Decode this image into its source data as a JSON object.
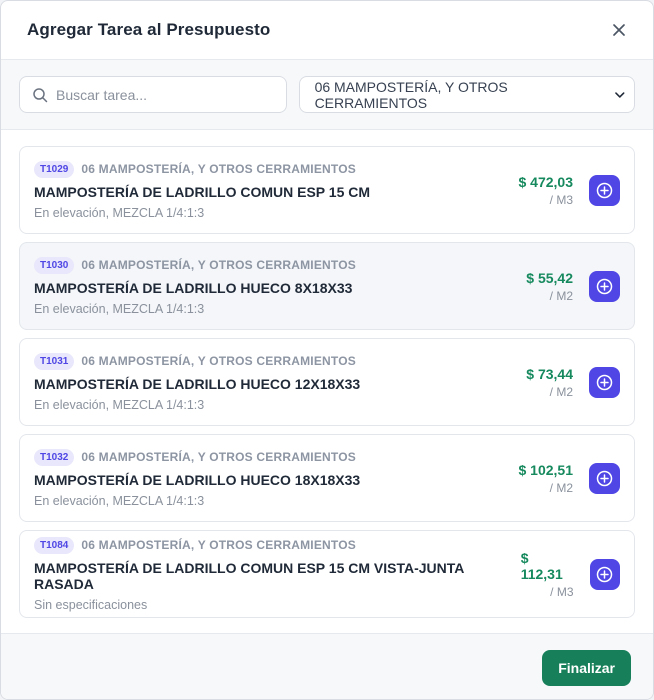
{
  "header": {
    "title": "Agregar Tarea al Presupuesto",
    "close_icon": "close-icon"
  },
  "toolbar": {
    "search_placeholder": "Buscar tarea...",
    "search_value": "",
    "category_selected": "06 MAMPOSTERÍA, Y OTROS CERRAMIENTOS"
  },
  "tasks": [
    {
      "code": "T1029",
      "category": "06 MAMPOSTERÍA, Y OTROS CERRAMIENTOS",
      "name": "MAMPOSTERÍA DE LADRILLO COMUN ESP 15 CM",
      "spec": "En elevación, MEZCLA 1/4:1:3",
      "price": "$ 472,03",
      "unit": "/ M3"
    },
    {
      "code": "T1030",
      "category": "06 MAMPOSTERÍA, Y OTROS CERRAMIENTOS",
      "name": "MAMPOSTERÍA DE LADRILLO HUECO 8X18X33",
      "spec": "En elevación, MEZCLA 1/4:1:3",
      "price": "$ 55,42",
      "unit": "/ M2"
    },
    {
      "code": "T1031",
      "category": "06 MAMPOSTERÍA, Y OTROS CERRAMIENTOS",
      "name": "MAMPOSTERÍA DE LADRILLO HUECO 12X18X33",
      "spec": "En elevación, MEZCLA 1/4:1:3",
      "price": "$ 73,44",
      "unit": "/ M2"
    },
    {
      "code": "T1032",
      "category": "06 MAMPOSTERÍA, Y OTROS CERRAMIENTOS",
      "name": "MAMPOSTERÍA DE LADRILLO HUECO 18X18X33",
      "spec": "En elevación, MEZCLA 1/4:1:3",
      "price": "$ 102,51",
      "unit": "/ M2"
    },
    {
      "code": "T1084",
      "category": "06 MAMPOSTERÍA, Y OTROS CERRAMIENTOS",
      "name": "MAMPOSTERÍA DE LADRILLO COMUN ESP 15 CM VISTA-JUNTA RASADA",
      "spec": "Sin especificaciones",
      "price": "$ 112,31",
      "unit": "/ M3"
    }
  ],
  "footer": {
    "finish_label": "Finalizar"
  },
  "colors": {
    "accent": "#4f46e5",
    "price": "#16895e",
    "finish_button": "#17805a"
  },
  "icons": {
    "search": "search-icon",
    "dropdown": "chevron-down-icon",
    "add": "plus-circle-icon"
  }
}
